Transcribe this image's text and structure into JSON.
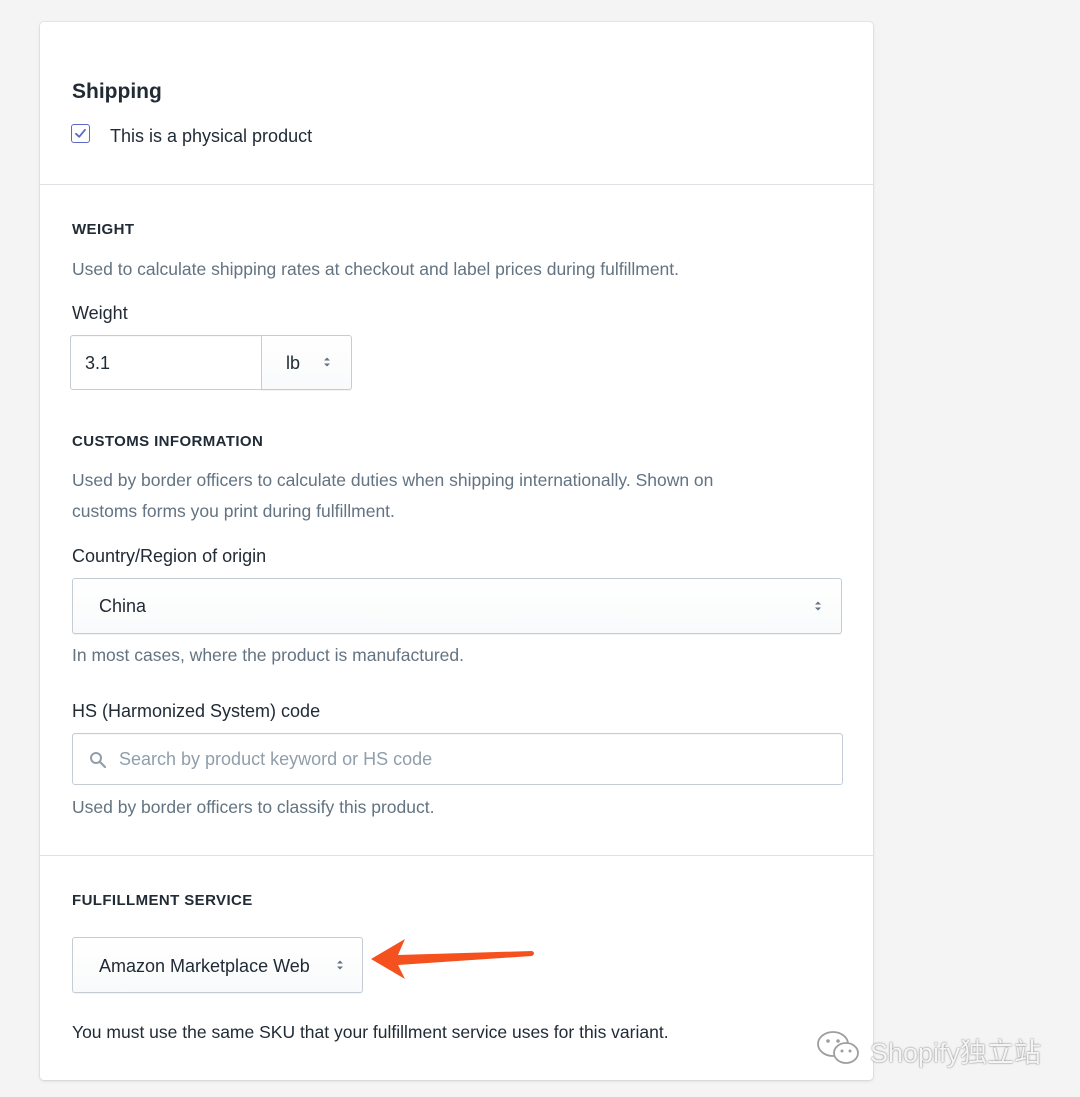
{
  "card": {
    "title": "Shipping",
    "physical_product": {
      "label": "This is a physical product",
      "checked": true
    }
  },
  "weight_section": {
    "heading": "WEIGHT",
    "help": "Used to calculate shipping rates at checkout and label prices during fulfillment.",
    "label": "Weight",
    "value": "3.1",
    "unit": "lb"
  },
  "customs": {
    "heading": "CUSTOMS INFORMATION",
    "help_line1": "Used by border officers to calculate duties when shipping internationally. Shown on",
    "help_line2": "customs forms you print during fulfillment.",
    "country_label": "Country/Region of origin",
    "country_value": "China",
    "country_help": "In most cases, where the product is manufactured.",
    "hs_label": "HS (Harmonized System) code",
    "hs_placeholder": "Search by product keyword or HS code",
    "hs_help": "Used by border officers to classify this product."
  },
  "fulfillment": {
    "heading": "FULFILLMENT SERVICE",
    "value": "Amazon Marketplace Web",
    "note": "You must use the same SKU that your fulfillment service uses for this variant."
  },
  "watermark": {
    "text": "Shopify独立站"
  },
  "colors": {
    "accent": "#5c6ac4",
    "annotation_arrow": "#f4511e",
    "help_text": "#637381"
  }
}
